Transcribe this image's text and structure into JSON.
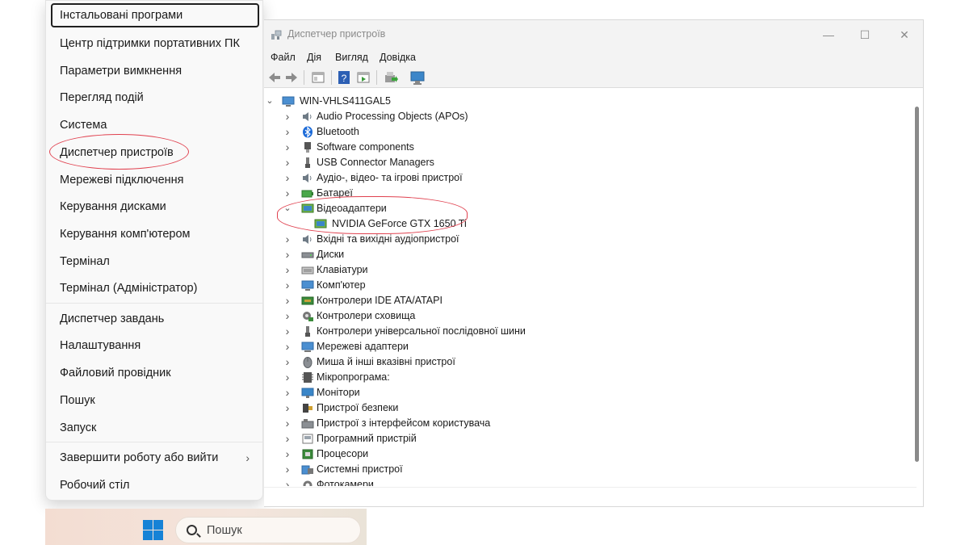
{
  "winx_menu": {
    "items": [
      {
        "label": "Інстальовані програми",
        "selected": true
      },
      {
        "label": "Центр підтримки портативних ПК"
      },
      {
        "label": "Параметри вимкнення"
      },
      {
        "label": "Перегляд подій"
      },
      {
        "label": "Система"
      },
      {
        "label": "Диспетчер пристроїв",
        "highlighted": true
      },
      {
        "label": "Мережеві підключення"
      },
      {
        "label": "Керування дисками"
      },
      {
        "label": "Керування комп'ютером"
      },
      {
        "label": "Термінал"
      },
      {
        "label": "Термінал (Адміністратор)"
      },
      {
        "label": "Диспетчер завдань"
      },
      {
        "label": "Налаштування"
      },
      {
        "label": "Файловий провідник"
      },
      {
        "label": "Пошук"
      },
      {
        "label": "Запуск"
      },
      {
        "label": "Завершити роботу або вийти",
        "has_submenu": true
      },
      {
        "label": "Робочий стіл"
      }
    ]
  },
  "taskbar": {
    "start_icon": "windows-logo-icon",
    "search_placeholder": "Пошук"
  },
  "device_manager": {
    "title": "Диспетчер пристроїв",
    "window_controls": {
      "minimize": "—",
      "maximize": "☐",
      "close": "✕"
    },
    "menus": [
      "Файл",
      "Дія",
      "Вигляд",
      "Довідка"
    ],
    "toolbar_icons": [
      "back-arrow-icon",
      "forward-arrow-icon",
      "properties-icon",
      "help-icon",
      "run-icon",
      "update-driver-icon",
      "scan-hardware-icon"
    ],
    "root": "WIN-VHLS411GAL5",
    "categories": [
      {
        "label": "Audio Processing Objects (APOs)",
        "icon": "speaker-icon"
      },
      {
        "label": "Bluetooth",
        "icon": "bluetooth-icon"
      },
      {
        "label": "Software components",
        "icon": "software-component-icon"
      },
      {
        "label": "USB Connector Managers",
        "icon": "usb-icon"
      },
      {
        "label": "Аудіо-, відео- та ігрові пристрої",
        "icon": "speaker-icon"
      },
      {
        "label": "Батареї",
        "icon": "battery-icon"
      },
      {
        "label": "Відеоадаптери",
        "icon": "display-adapter-icon",
        "expanded": true,
        "children": [
          {
            "label": "NVIDIA GeForce GTX 1650 Ti",
            "icon": "display-adapter-icon"
          }
        ]
      },
      {
        "label": "Вхідні та вихідні аудіопристрої",
        "icon": "speaker-icon"
      },
      {
        "label": "Диски",
        "icon": "disk-drive-icon"
      },
      {
        "label": "Клавіатури",
        "icon": "keyboard-icon"
      },
      {
        "label": "Комп'ютер",
        "icon": "computer-icon"
      },
      {
        "label": "Контролери IDE ATA/ATAPI",
        "icon": "ide-controller-icon"
      },
      {
        "label": "Контролери сховища",
        "icon": "storage-controller-icon"
      },
      {
        "label": "Контролери універсальної послідовної шини",
        "icon": "usb-icon"
      },
      {
        "label": "Мережеві адаптери",
        "icon": "network-adapter-icon"
      },
      {
        "label": "Миша й інші вказівні пристрої",
        "icon": "mouse-icon"
      },
      {
        "label": "Мікропрограма:",
        "icon": "firmware-icon"
      },
      {
        "label": "Монітори",
        "icon": "monitor-icon"
      },
      {
        "label": "Пристрої безпеки",
        "icon": "security-device-icon"
      },
      {
        "label": "Пристрої з інтерфейсом користувача",
        "icon": "hid-icon"
      },
      {
        "label": "Програмний пристрій",
        "icon": "software-device-icon"
      },
      {
        "label": "Процесори",
        "icon": "processor-icon"
      },
      {
        "label": "Системні пристрої",
        "icon": "system-devices-icon"
      },
      {
        "label": "Фотокамери",
        "icon": "camera-icon"
      }
    ]
  },
  "colors": {
    "highlight_ellipse": "#e0414f",
    "accent_blue": "#1682d6",
    "window_chrome": "#f3f3f3"
  }
}
